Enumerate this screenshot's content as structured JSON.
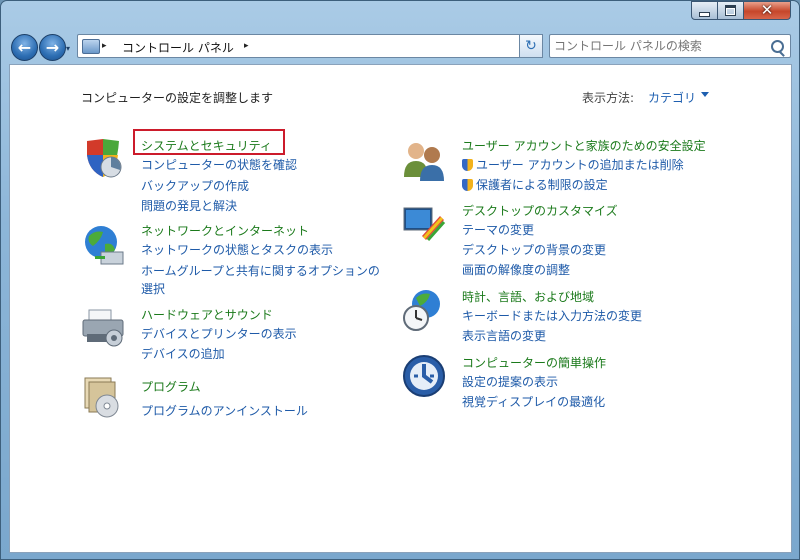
{
  "window": {
    "close_glyph": "✕",
    "minimize_label": "",
    "maximize_label": ""
  },
  "nav": {
    "back_glyph": "←",
    "forward_glyph": "→",
    "history_glyph": "▾",
    "refresh_glyph": "↻"
  },
  "address": {
    "path": "コントロール パネル",
    "separator": "▸"
  },
  "search": {
    "placeholder": "コントロール パネルの検索"
  },
  "page": {
    "heading": "コンピューターの設定を調整します",
    "view_by_label": "表示方法:",
    "view_by_value": "カテゴリ"
  },
  "categories": [
    {
      "icon": "system-security-icon",
      "title": "システムとセキュリティ",
      "links": [
        "コンピューターの状態を確認",
        "バックアップの作成",
        "問題の発見と解決"
      ]
    },
    {
      "icon": "network-internet-icon",
      "title": "ネットワークとインターネット",
      "links": [
        "ネットワークの状態とタスクの表示",
        "ホームグループと共有に関するオプションの",
        "選択"
      ]
    },
    {
      "icon": "hardware-sound-icon",
      "title": "ハードウェアとサウンド",
      "links": [
        "デバイスとプリンターの表示",
        "デバイスの追加"
      ]
    },
    {
      "icon": "programs-icon",
      "title": "プログラム",
      "links": [
        "プログラムのアンインストール"
      ]
    },
    {
      "icon": "user-accounts-icon",
      "title": "ユーザー アカウントと家族のための安全設定",
      "links": [
        "ユーザー アカウントの追加または削除",
        "保護者による制限の設定"
      ]
    },
    {
      "icon": "appearance-icon",
      "title": "デスクトップのカスタマイズ",
      "links": [
        "テーマの変更",
        "デスクトップの背景の変更",
        "画面の解像度の調整"
      ]
    },
    {
      "icon": "clock-region-icon",
      "title": "時計、言語、および地域",
      "links": [
        "キーボードまたは入力方法の変更",
        "表示言語の変更"
      ]
    },
    {
      "icon": "ease-of-access-icon",
      "title": "コンピューターの簡単操作",
      "links": [
        "設定の提案の表示",
        "視覚ディスプレイの最適化"
      ]
    }
  ]
}
